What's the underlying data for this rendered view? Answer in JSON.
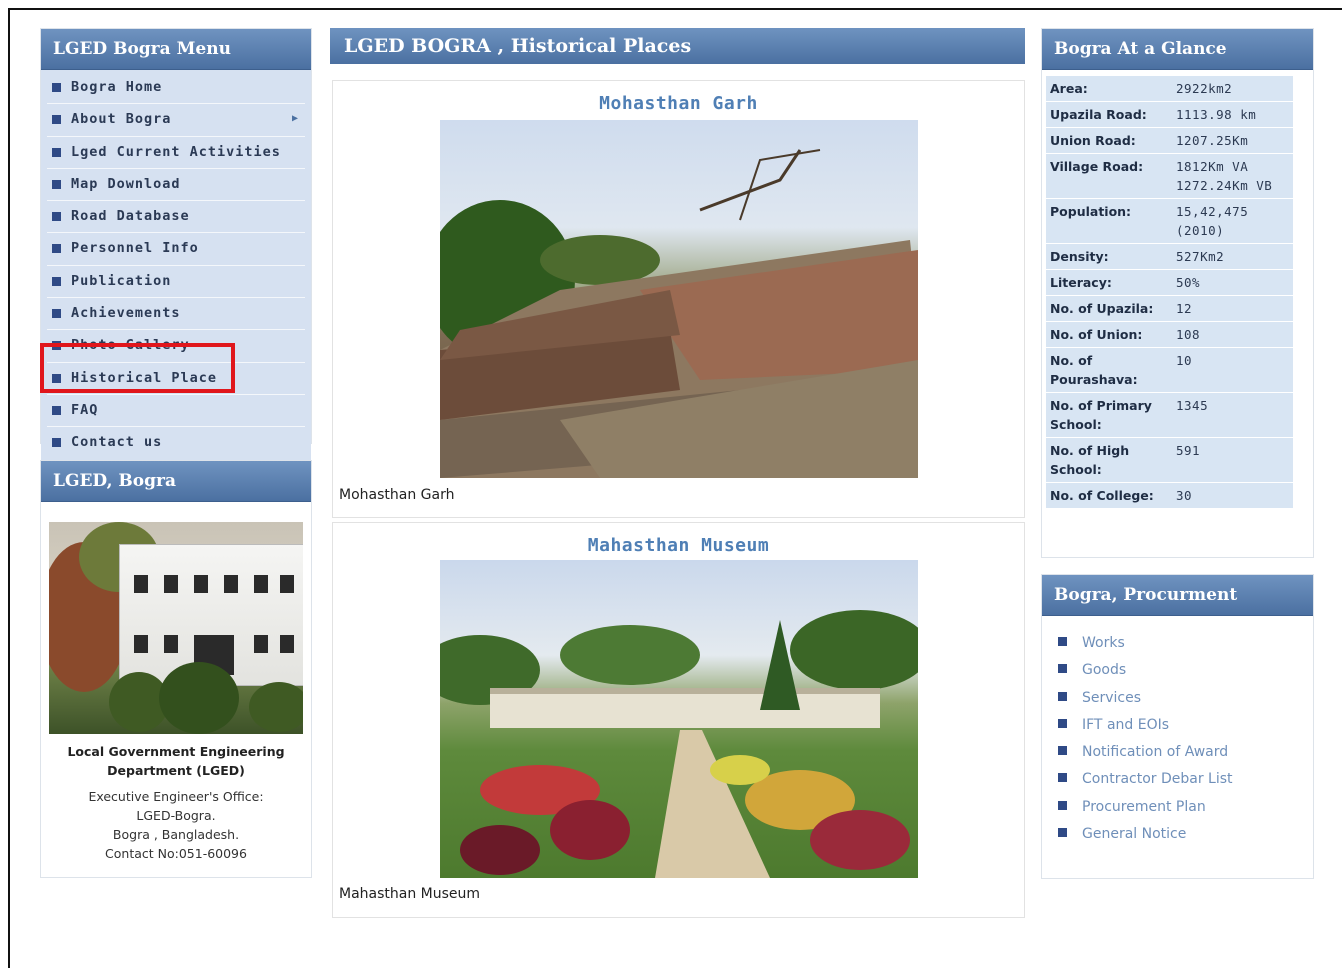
{
  "menu": {
    "title": "LGED Bogra Menu",
    "items": [
      {
        "label": "Bogra Home",
        "submenu": false
      },
      {
        "label": "About Bogra",
        "submenu": true
      },
      {
        "label": "Lged Current Activities",
        "submenu": false
      },
      {
        "label": "Map Download",
        "submenu": false
      },
      {
        "label": "Road Database",
        "submenu": false
      },
      {
        "label": "Personnel Info",
        "submenu": false
      },
      {
        "label": "Publication",
        "submenu": false
      },
      {
        "label": "Achievements",
        "submenu": false
      },
      {
        "label": "Photo Gallery",
        "submenu": false
      },
      {
        "label": "Historical Place",
        "submenu": false,
        "highlighted": true
      },
      {
        "label": "FAQ",
        "submenu": false
      },
      {
        "label": "Contact us",
        "submenu": false
      }
    ],
    "highlight_color": "#e0161c"
  },
  "lged_card": {
    "title": "LGED, Bogra",
    "caption_bold_1": "Local Government Engineering",
    "caption_bold_2": "Department (LGED)",
    "line1": "Executive Engineer's Office:",
    "line2": "LGED-Bogra.",
    "line3": "Bogra , Bangladesh.",
    "line4": "Contact No:051-60096"
  },
  "main": {
    "title": "LGED BOGRA , Historical Places",
    "places": [
      {
        "title": "Mohasthan Garh",
        "caption": "Mohasthan Garh"
      },
      {
        "title": "Mahasthan Museum",
        "caption": "Mahasthan Museum"
      }
    ]
  },
  "glance": {
    "title": "Bogra At a Glance",
    "rows": [
      {
        "k": "Area:",
        "v": "2922km2"
      },
      {
        "k": "Upazila Road:",
        "v": "1113.98 km"
      },
      {
        "k": "Union Road:",
        "v": "1207.25Km"
      },
      {
        "k": "Village Road:",
        "v": "1812Km VA",
        "v2": "1272.24Km VB"
      },
      {
        "k": "Population:",
        "v": "15,42,475",
        "v2": "(2010)"
      },
      {
        "k": "Density:",
        "v": "527Km2"
      },
      {
        "k": "Literacy:",
        "v": "50%"
      },
      {
        "k": "No. of Upazila:",
        "v": "12"
      },
      {
        "k": "No. of Union:",
        "v": "108"
      },
      {
        "k": "No. of",
        "k2": "Pourashava:",
        "v": "10"
      },
      {
        "k": "No. of Primary",
        "k2": "School:",
        "v": "1345"
      },
      {
        "k": "No. of High",
        "k2": "School:",
        "v": "591"
      },
      {
        "k": "No. of College:",
        "v": "30"
      }
    ]
  },
  "procurement": {
    "title": "Bogra, Procurment",
    "items": [
      "Works",
      "Goods",
      "Services",
      "IFT and EOIs",
      "Notification of Award",
      "Contractor Debar List",
      "Procurement Plan",
      "General Notice"
    ]
  },
  "colors": {
    "header": "#4b70a1",
    "menu_bg": "#d6e1f1",
    "link": "#6f8fb9",
    "title_blue": "#4f7fb5"
  }
}
